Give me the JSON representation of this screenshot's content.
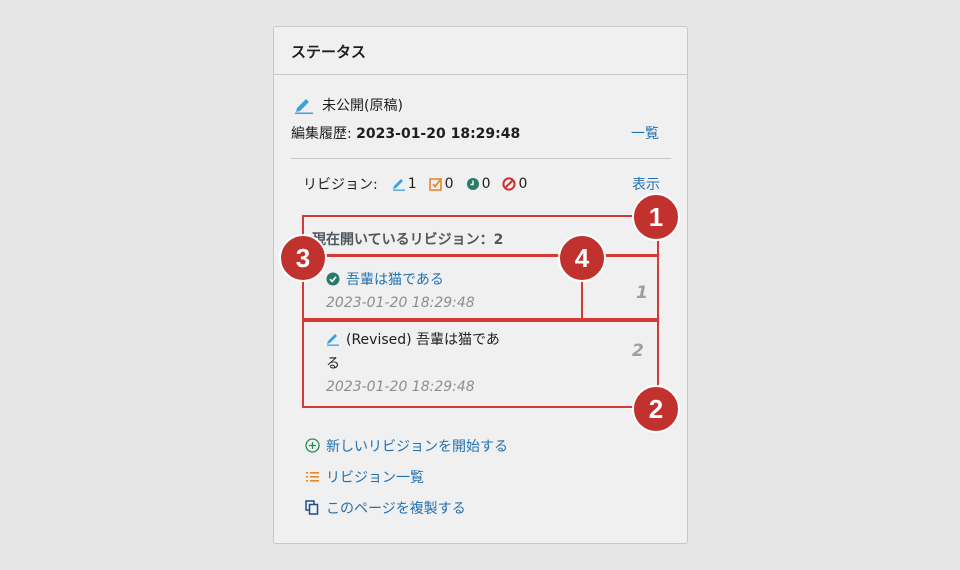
{
  "panel": {
    "title": "ステータス",
    "status_label": "未公開(原稿)",
    "history_label": "編集履歴: ",
    "history_date": "2023-01-20 18:29:48",
    "history_link": "一覧"
  },
  "revisions": {
    "label": "リビジョン:",
    "drafts": "1",
    "pending": "0",
    "scheduled": "0",
    "rejected": "0",
    "show_link": "表示",
    "open_title": "現在開いているリビジョン：2",
    "items": [
      {
        "title": "吾輩は猫である",
        "date": "2023-01-20 18:29:48",
        "index": "1"
      },
      {
        "title_line1": "(Revised) 吾輩は猫であ",
        "title_line2": "る",
        "date": "2023-01-20 18:29:48",
        "index": "2"
      }
    ]
  },
  "actions": {
    "new_revision": "新しいリビジョンを開始する",
    "revision_list": "リビジョン一覧",
    "duplicate": "このページを複製する"
  },
  "badges": [
    "1",
    "2",
    "3",
    "4"
  ],
  "colors": {
    "link": "#2271b1",
    "highlight": "#d23b36",
    "badge": "#c1322f"
  }
}
